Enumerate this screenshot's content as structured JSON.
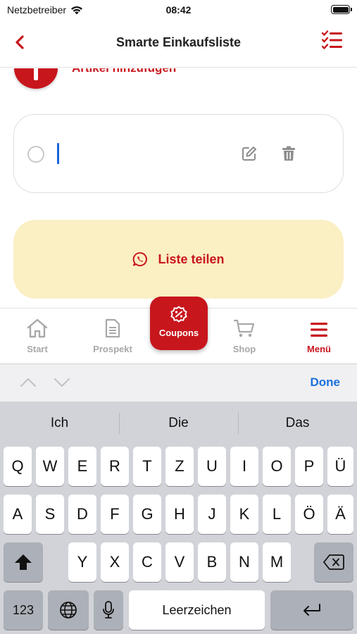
{
  "status_bar": {
    "carrier": "Netzbetreiber",
    "time": "08:42"
  },
  "header": {
    "title": "Smarte Einkaufsliste"
  },
  "content": {
    "add_item_label": "Artikel hinzufügen",
    "item_input_value": "",
    "share_label": "Liste teilen"
  },
  "tabbar": {
    "start": "Start",
    "prospekt": "Prospekt",
    "coupons": "Coupons",
    "shop": "Shop",
    "menu": "Menü"
  },
  "accessory": {
    "done": "Done"
  },
  "keyboard": {
    "suggestions": [
      "Ich",
      "Die",
      "Das"
    ],
    "row1": [
      "Q",
      "W",
      "E",
      "R",
      "T",
      "Z",
      "U",
      "I",
      "O",
      "P",
      "Ü"
    ],
    "row2": [
      "A",
      "S",
      "D",
      "F",
      "G",
      "H",
      "J",
      "K",
      "L",
      "Ö",
      "Ä"
    ],
    "row3": [
      "Y",
      "X",
      "C",
      "V",
      "B",
      "N",
      "M"
    ],
    "numbers_key": "123",
    "space_key": "Leerzeichen"
  },
  "colors": {
    "brand_red": "#c8161d",
    "share_bg": "#fbefc4",
    "ios_blue": "#1a6fdb"
  }
}
